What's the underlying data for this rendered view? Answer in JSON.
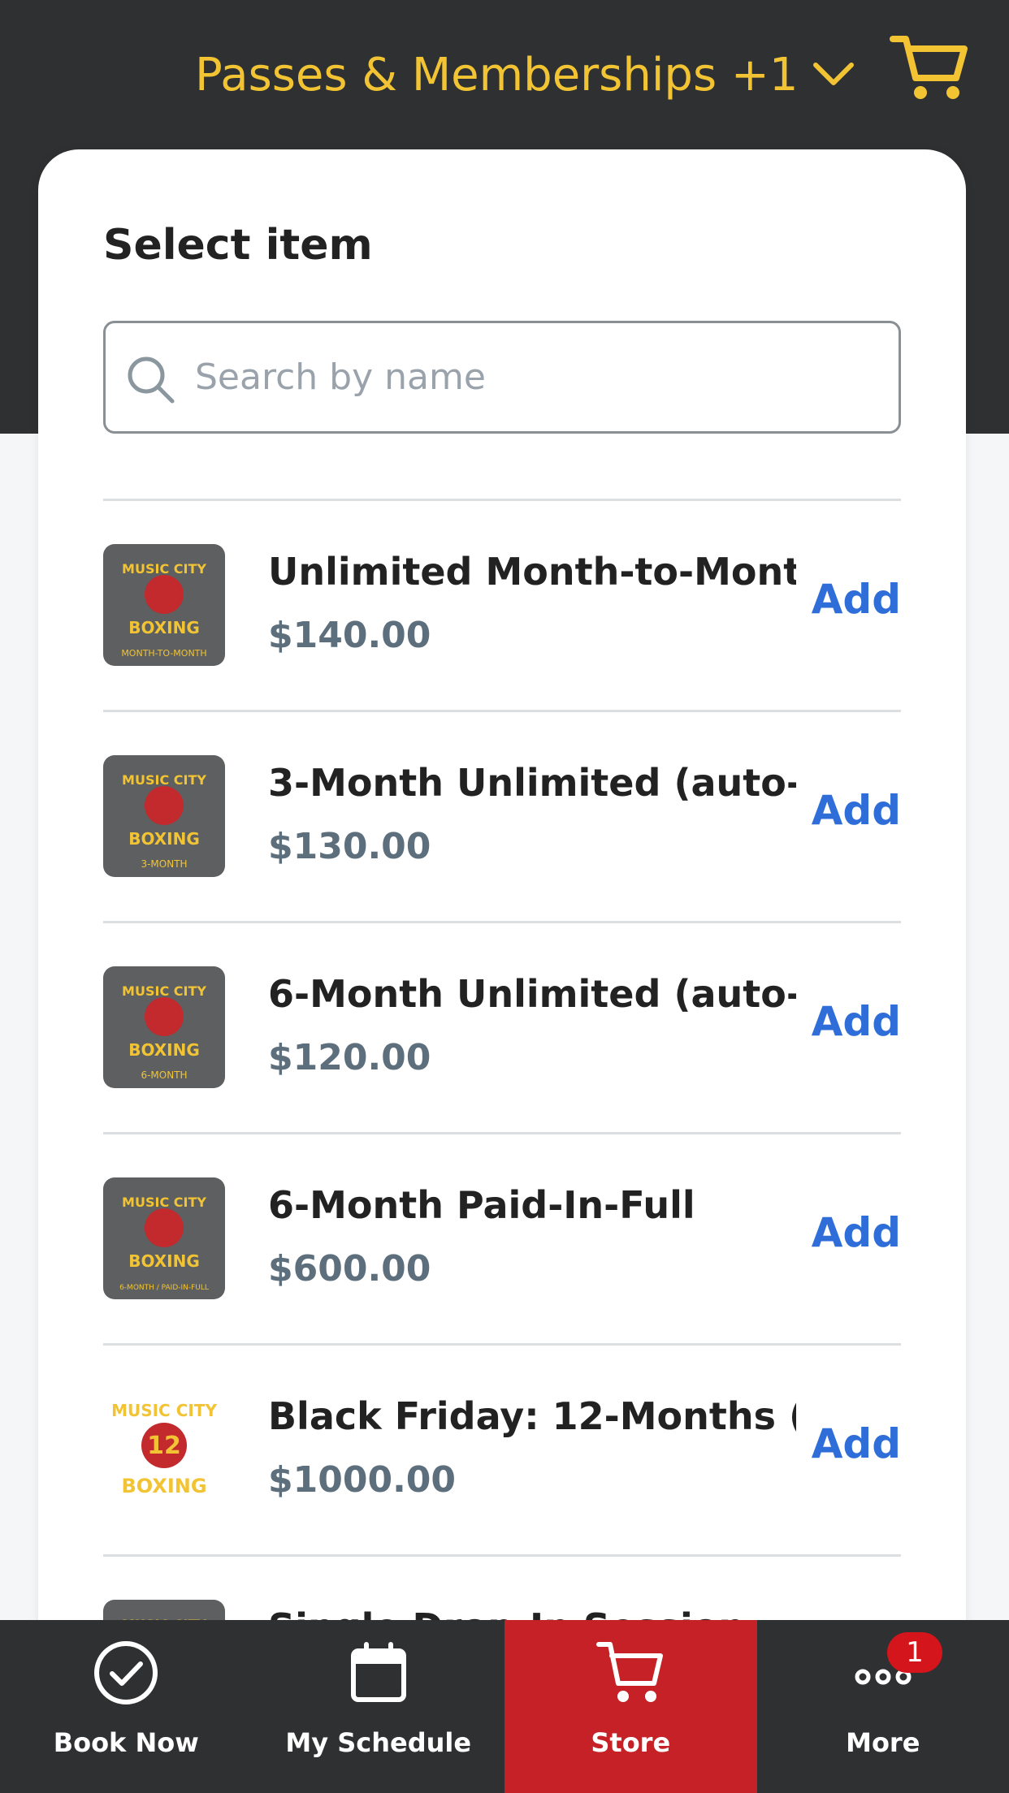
{
  "header": {
    "title": "Passes & Memberships +1",
    "accent_color": "#f2c434",
    "cart_icon": "cart-icon"
  },
  "card": {
    "title": "Select item",
    "search": {
      "placeholder": "Search by name",
      "value": ""
    }
  },
  "items": [
    {
      "name": "Unlimited Month-to-Mont...",
      "price": "$140.00",
      "add_label": "Add",
      "thumb_logo": "MUSIC CITY BOXING",
      "thumb_caption": "MONTH-TO-MONTH"
    },
    {
      "name": "3-Month Unlimited (auto-...",
      "price": "$130.00",
      "add_label": "Add",
      "thumb_logo": "MUSIC CITY BOXING",
      "thumb_caption": "3-MONTH"
    },
    {
      "name": "6-Month Unlimited (auto-...",
      "price": "$120.00",
      "add_label": "Add",
      "thumb_logo": "MUSIC CITY BOXING",
      "thumb_caption": "6-MONTH"
    },
    {
      "name": "6-Month Paid-In-Full",
      "price": "$600.00",
      "add_label": "Add",
      "thumb_logo": "MUSIC CITY BOXING",
      "thumb_caption": "6-MONTH / PAID-IN-FULL"
    },
    {
      "name": "Black Friday: 12-Months (...",
      "price": "$1000.00",
      "add_label": "Add",
      "thumb_logo": "MUSIC CITY BOXING",
      "thumb_caption": "12"
    },
    {
      "name": "Single Drop-In Session",
      "price": "",
      "add_label": "",
      "thumb_logo": "MUSIC CITY",
      "thumb_caption": ""
    }
  ],
  "nav": {
    "items": [
      {
        "label": "Book Now",
        "icon": "check-circle-icon"
      },
      {
        "label": "My Schedule",
        "icon": "calendar-icon"
      },
      {
        "label": "Store",
        "icon": "cart-icon"
      },
      {
        "label": "More",
        "icon": "more-icon"
      }
    ],
    "more_badge": "1",
    "active_color": "#c62127"
  }
}
